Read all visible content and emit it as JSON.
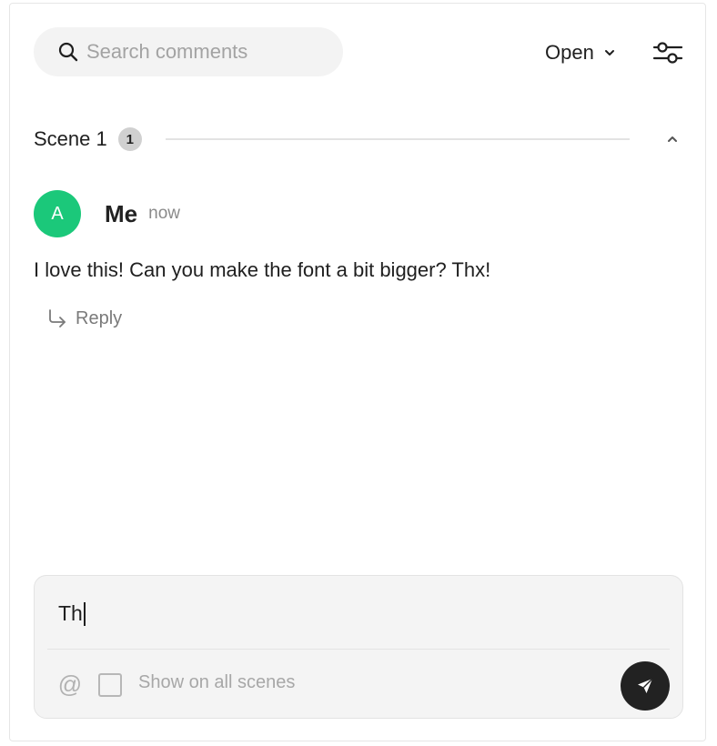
{
  "search": {
    "placeholder": "Search comments",
    "icon": "search-icon"
  },
  "filter": {
    "selected": "Open",
    "icon": "chevron-down-icon"
  },
  "settings": {
    "icon": "sliders-icon"
  },
  "scene": {
    "title": "Scene 1",
    "count": "1",
    "collapse_icon": "chevron-up-icon"
  },
  "comment": {
    "avatar_initial": "A",
    "avatar_color": "#1bc87a",
    "author": "Me",
    "timestamp": "now",
    "body": "I love this! Can you make the font a bit bigger? Thx!",
    "reply_label": "Reply",
    "reply_icon": "reply-arrow-icon"
  },
  "composer": {
    "value": "Th",
    "mention_symbol": "@",
    "show_all_label": "Show on all scenes",
    "send_icon": "send-icon"
  }
}
